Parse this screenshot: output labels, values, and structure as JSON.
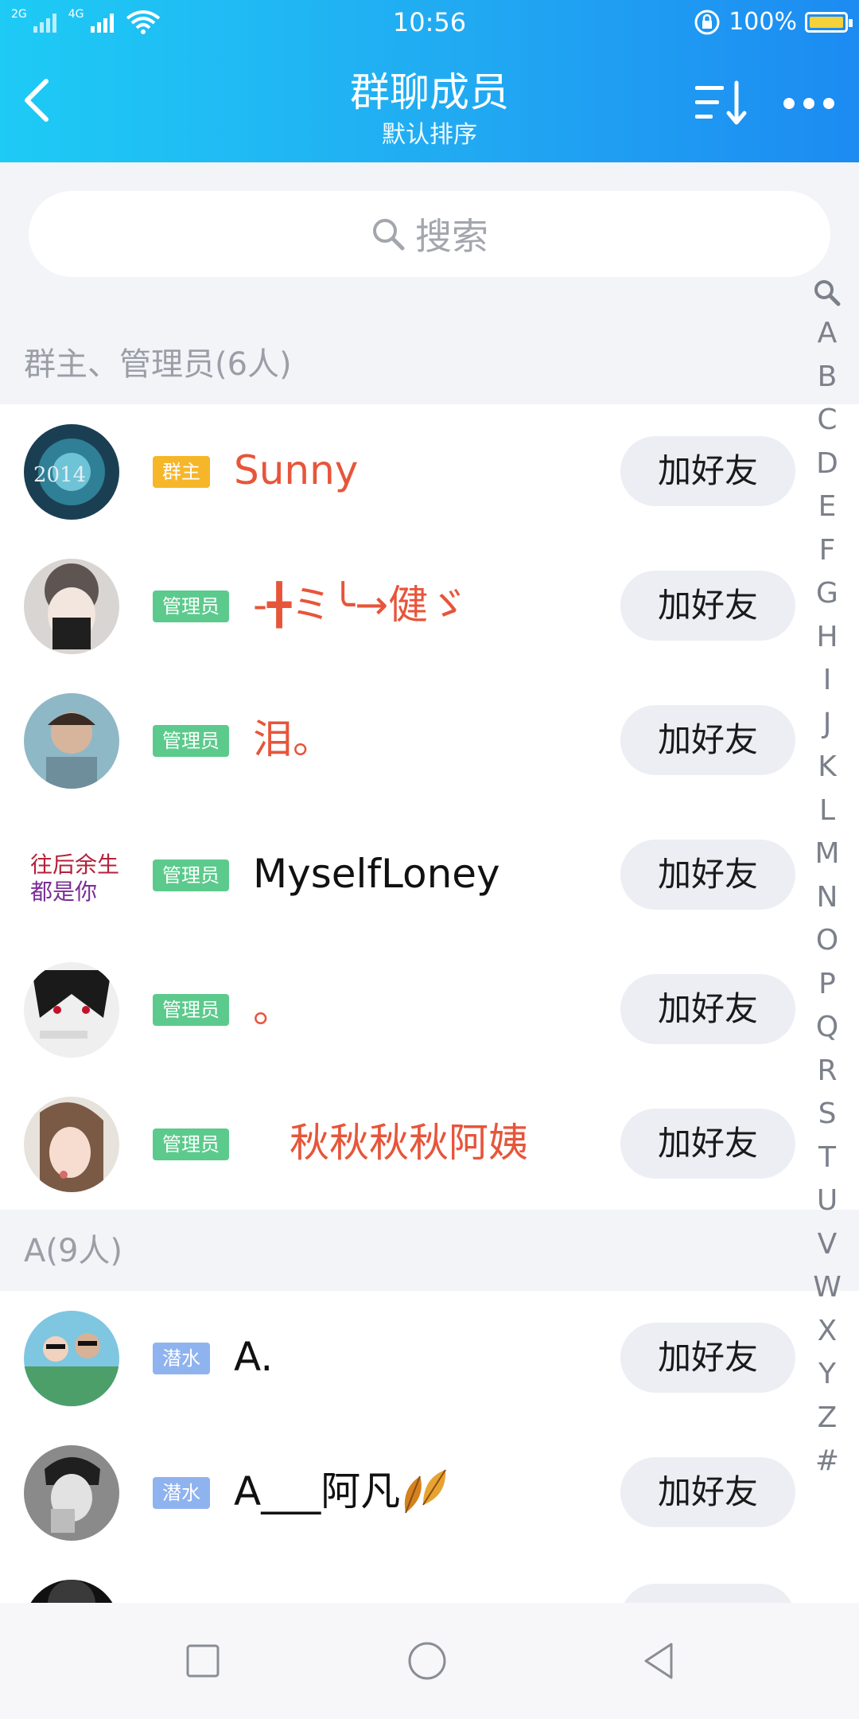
{
  "status": {
    "signal_left": "2G",
    "signal_right": "4G",
    "time": "10:56",
    "battery": "100%"
  },
  "header": {
    "title": "群聊成员",
    "subtitle": "默认排序"
  },
  "search": {
    "placeholder": "搜索"
  },
  "sections": [
    {
      "title": "群主、管理员(6人)",
      "members": [
        {
          "badge": "群主",
          "badge_color": "#f6b629",
          "name": "Sunny",
          "name_style": "red",
          "action": "加好友"
        },
        {
          "badge": "管理员",
          "badge_color": "#5cca8c",
          "name": "-╋ミ╰→健ゞ",
          "name_style": "red",
          "action": "加好友"
        },
        {
          "badge": "管理员",
          "badge_color": "#5cca8c",
          "name": "泪。",
          "name_style": "red",
          "action": "加好友"
        },
        {
          "badge": "管理员",
          "badge_color": "#5cca8c",
          "name": "MyselfLoney",
          "name_style": "black",
          "action": "加好友"
        },
        {
          "badge": "管理员",
          "badge_color": "#5cca8c",
          "name": "。",
          "name_style": "red",
          "action": "加好友"
        },
        {
          "badge": "管理员",
          "badge_color": "#5cca8c",
          "name": "秋秋秋秋阿姨",
          "name_style": "red",
          "action": "加好友"
        }
      ]
    },
    {
      "title": "A(9人)",
      "members": [
        {
          "badge": "潜水",
          "badge_color": "#8fb3ef",
          "name": "A.",
          "name_style": "black",
          "action": "加好友"
        },
        {
          "badge": "潜水",
          "badge_color": "#8fb3ef",
          "name": "A___阿凡",
          "name_style": "black",
          "action": "加好友"
        }
      ]
    }
  ],
  "index_letters": [
    "A",
    "B",
    "C",
    "D",
    "E",
    "F",
    "G",
    "H",
    "I",
    "J",
    "K",
    "L",
    "M",
    "N",
    "O",
    "P",
    "Q",
    "R",
    "S",
    "T",
    "U",
    "V",
    "W",
    "X",
    "Y",
    "Z",
    "#"
  ],
  "colors": {
    "header_gradient_start": "#1ecbf5",
    "header_gradient_end": "#1c8bf2",
    "admin_name_red": "#e7553a"
  }
}
